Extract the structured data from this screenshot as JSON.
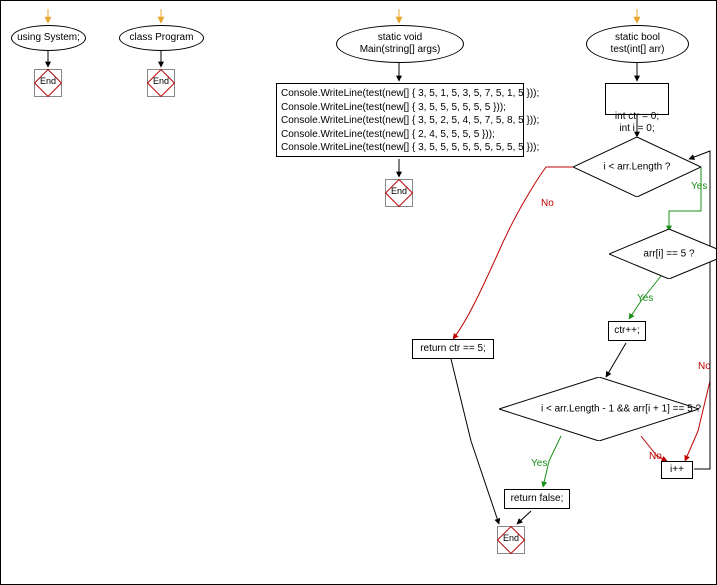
{
  "chart_data": {
    "type": "flowchart",
    "entries": [
      {
        "id": "entry_using",
        "type": "ellipse",
        "text": "using System;"
      },
      {
        "id": "entry_class",
        "type": "ellipse",
        "text": "class Program"
      },
      {
        "id": "entry_main",
        "type": "ellipse",
        "text": "static void\nMain(string[] args)"
      },
      {
        "id": "entry_test",
        "type": "ellipse",
        "text": "static bool\ntest(int[] arr)"
      }
    ],
    "main_body": [
      "Console.WriteLine(test(new[] { 3, 5, 1, 5, 3, 5, 7, 5, 1, 5 }));",
      "Console.WriteLine(test(new[] { 3, 5, 5, 5, 5, 5, 5 }));",
      "Console.WriteLine(test(new[] { 3, 5, 2, 5, 4, 5, 7, 5, 8, 5 }));",
      "Console.WriteLine(test(new[] { 2, 4, 5, 5, 5, 5 }));",
      "Console.WriteLine(test(new[] { 3, 5, 5, 5, 5, 5, 5, 5, 5, 5 }));"
    ],
    "test_body": {
      "init": "int ctr = 0;\nint i = 0;",
      "cond_loop": "i < arr.Length ?",
      "cond_eq5": "arr[i] == 5 ?",
      "inc_ctr": "ctr++;",
      "cond_next": "i < arr.Length - 1 && arr[i + 1] == 5 ?",
      "ret_false": "return false;",
      "inc_i": "i++",
      "ret_ctr": "return ctr == 5;"
    },
    "labels": {
      "yes": "Yes",
      "no": "No",
      "end": "End"
    }
  }
}
